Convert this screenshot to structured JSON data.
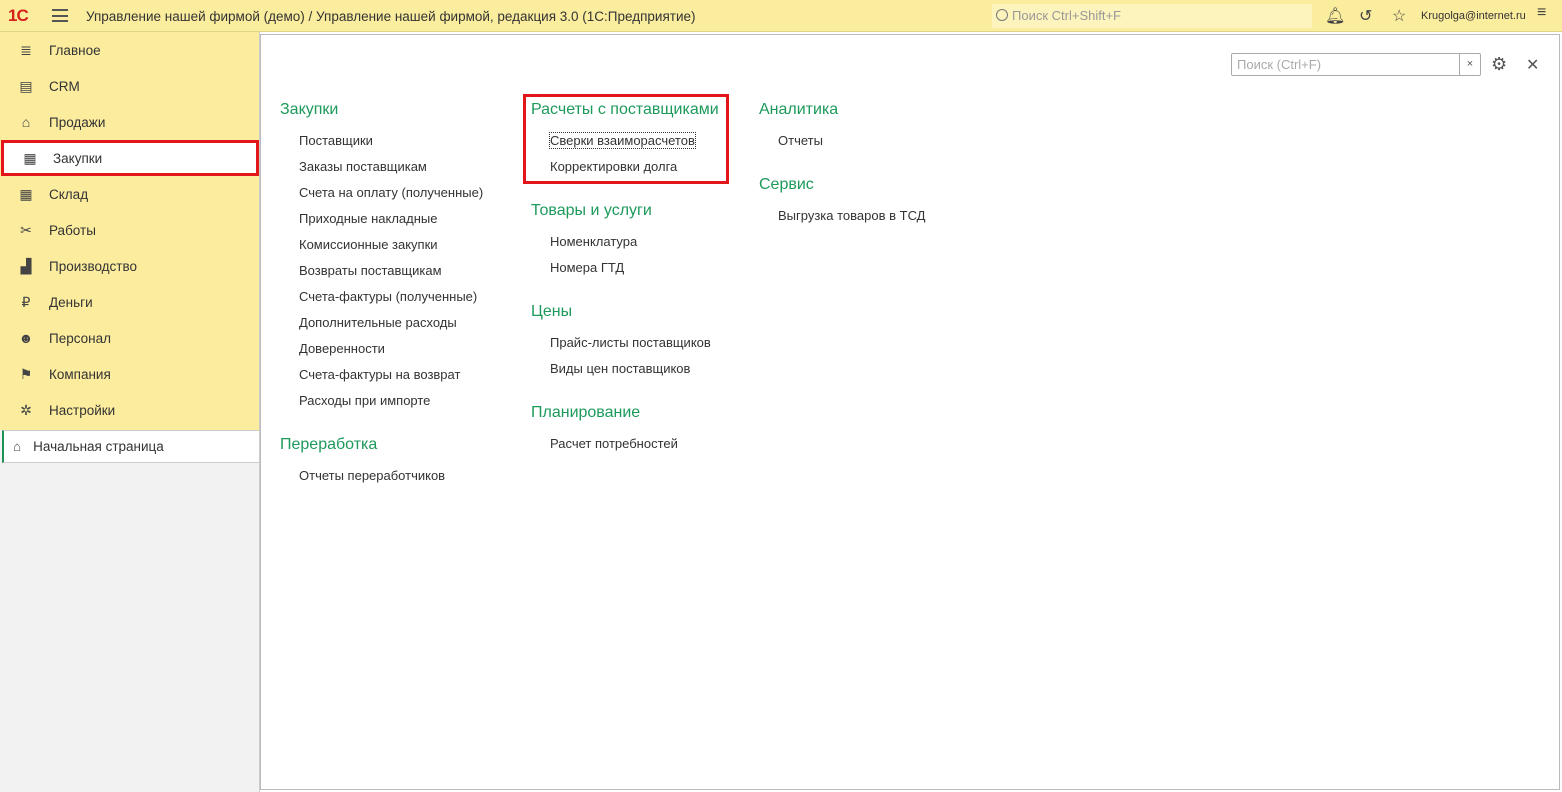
{
  "header": {
    "logo": "1С",
    "title": "Управление нашей фирмой (демо) / Управление нашей фирмой, редакция 3.0  (1С:Предприятие)",
    "search_placeholder": "Поиск Ctrl+Shift+F",
    "user": "Krugolga@internet.ru"
  },
  "sidebar": {
    "items": [
      {
        "label": "Главное",
        "icon": "≣"
      },
      {
        "label": "CRM",
        "icon": "▤"
      },
      {
        "label": "Продажи",
        "icon": "⌂"
      },
      {
        "label": "Закупки",
        "icon": "▦"
      },
      {
        "label": "Склад",
        "icon": "▦"
      },
      {
        "label": "Работы",
        "icon": "✂"
      },
      {
        "label": "Производство",
        "icon": "▟"
      },
      {
        "label": "Деньги",
        "icon": "₽"
      },
      {
        "label": "Персонал",
        "icon": "☻"
      },
      {
        "label": "Компания",
        "icon": "⚑"
      },
      {
        "label": "Настройки",
        "icon": "✲"
      }
    ],
    "active": "Закупки",
    "home": "Начальная страница"
  },
  "main": {
    "search_placeholder": "Поиск (Ctrl+F)",
    "columns": [
      [
        {
          "title": "Закупки",
          "items": [
            "Поставщики",
            "Заказы поставщикам",
            "Счета на оплату (полученные)",
            "Приходные накладные",
            "Комиссионные закупки",
            "Возвраты поставщикам",
            "Счета-фактуры (полученные)",
            "Дополнительные расходы",
            "Доверенности",
            "Счета-фактуры на возврат",
            "Расходы при импорте"
          ]
        },
        {
          "title": "Переработка",
          "items": [
            "Отчеты переработчиков"
          ]
        }
      ],
      [
        {
          "title": "Расчеты с поставщиками",
          "items": [
            "Сверки взаиморасчетов",
            "Корректировки долга"
          ]
        },
        {
          "title": "Товары и услуги",
          "items": [
            "Номенклатура",
            "Номера ГТД"
          ]
        },
        {
          "title": "Цены",
          "items": [
            "Прайс-листы поставщиков",
            "Виды цен поставщиков"
          ]
        },
        {
          "title": "Планирование",
          "items": [
            "Расчет потребностей"
          ]
        }
      ],
      [
        {
          "title": "Аналитика",
          "items": [
            "Отчеты"
          ]
        },
        {
          "title": "Сервис",
          "items": [
            "Выгрузка товаров в ТСД"
          ]
        }
      ]
    ]
  },
  "colors": {
    "accent": "#1d9a5b",
    "highlight": "#e2151b",
    "panel": "#fbec9e"
  }
}
